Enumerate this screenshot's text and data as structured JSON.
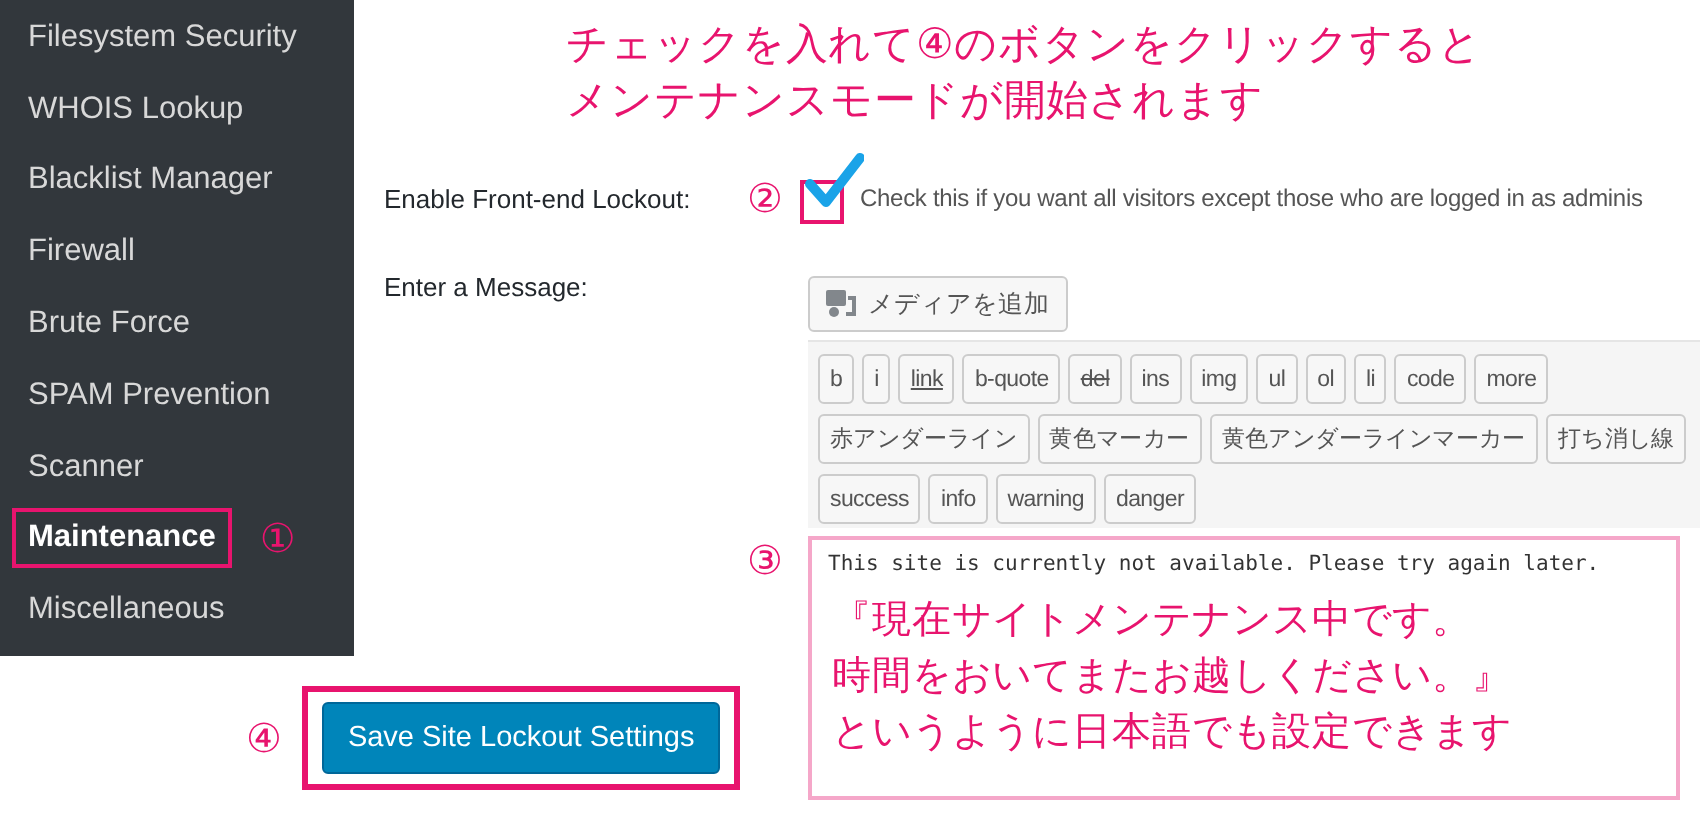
{
  "sidebar": {
    "items": [
      {
        "label": "Filesystem Security",
        "selected": false
      },
      {
        "label": "WHOIS Lookup",
        "selected": false
      },
      {
        "label": "Blacklist Manager",
        "selected": false
      },
      {
        "label": "Firewall",
        "selected": false
      },
      {
        "label": "Brute Force",
        "selected": false
      },
      {
        "label": "SPAM Prevention",
        "selected": false
      },
      {
        "label": "Scanner",
        "selected": false
      },
      {
        "label": "Maintenance",
        "selected": true,
        "marker": "①"
      },
      {
        "label": "Miscellaneous",
        "selected": false
      }
    ]
  },
  "instruction": [
    "チェックを入れて④のボタンをクリックすると",
    "メンテナンスモードが開始されます"
  ],
  "lockout": {
    "label": "Enable Front-end Lockout:",
    "marker": "②",
    "checked": true,
    "description": "Check this if you want all visitors except those who are logged in as adminis"
  },
  "message": {
    "label": "Enter a Message:",
    "media_button": "メディアを追加",
    "marker": "③",
    "toolbar_rows": [
      [
        {
          "label": "b",
          "kind": "plain"
        },
        {
          "label": "i",
          "kind": "plain"
        },
        {
          "label": "link",
          "kind": "link"
        },
        {
          "label": "b-quote",
          "kind": "plain"
        },
        {
          "label": "del",
          "kind": "del"
        },
        {
          "label": "ins",
          "kind": "plain"
        },
        {
          "label": "img",
          "kind": "plain"
        },
        {
          "label": "ul",
          "kind": "plain"
        },
        {
          "label": "ol",
          "kind": "plain"
        },
        {
          "label": "li",
          "kind": "plain"
        },
        {
          "label": "code",
          "kind": "plain"
        },
        {
          "label": "more",
          "kind": "plain"
        }
      ],
      [
        {
          "label": "赤アンダーライン",
          "kind": "plain"
        },
        {
          "label": "黄色マーカー",
          "kind": "plain"
        },
        {
          "label": "黄色アンダーラインマーカー",
          "kind": "plain"
        },
        {
          "label": "打ち消し線",
          "kind": "plain"
        }
      ],
      [
        {
          "label": "success",
          "kind": "plain"
        },
        {
          "label": "info",
          "kind": "plain"
        },
        {
          "label": "warning",
          "kind": "plain"
        },
        {
          "label": "danger",
          "kind": "plain"
        }
      ]
    ],
    "value": "This site is currently not available. Please try again later.",
    "note": [
      "『現在サイトメンテナンス中です。",
      "時間をおいてまたお越しください。』",
      "というように日本語でも設定できます"
    ]
  },
  "save": {
    "marker": "④",
    "button": "Save Site Lockout Settings"
  }
}
